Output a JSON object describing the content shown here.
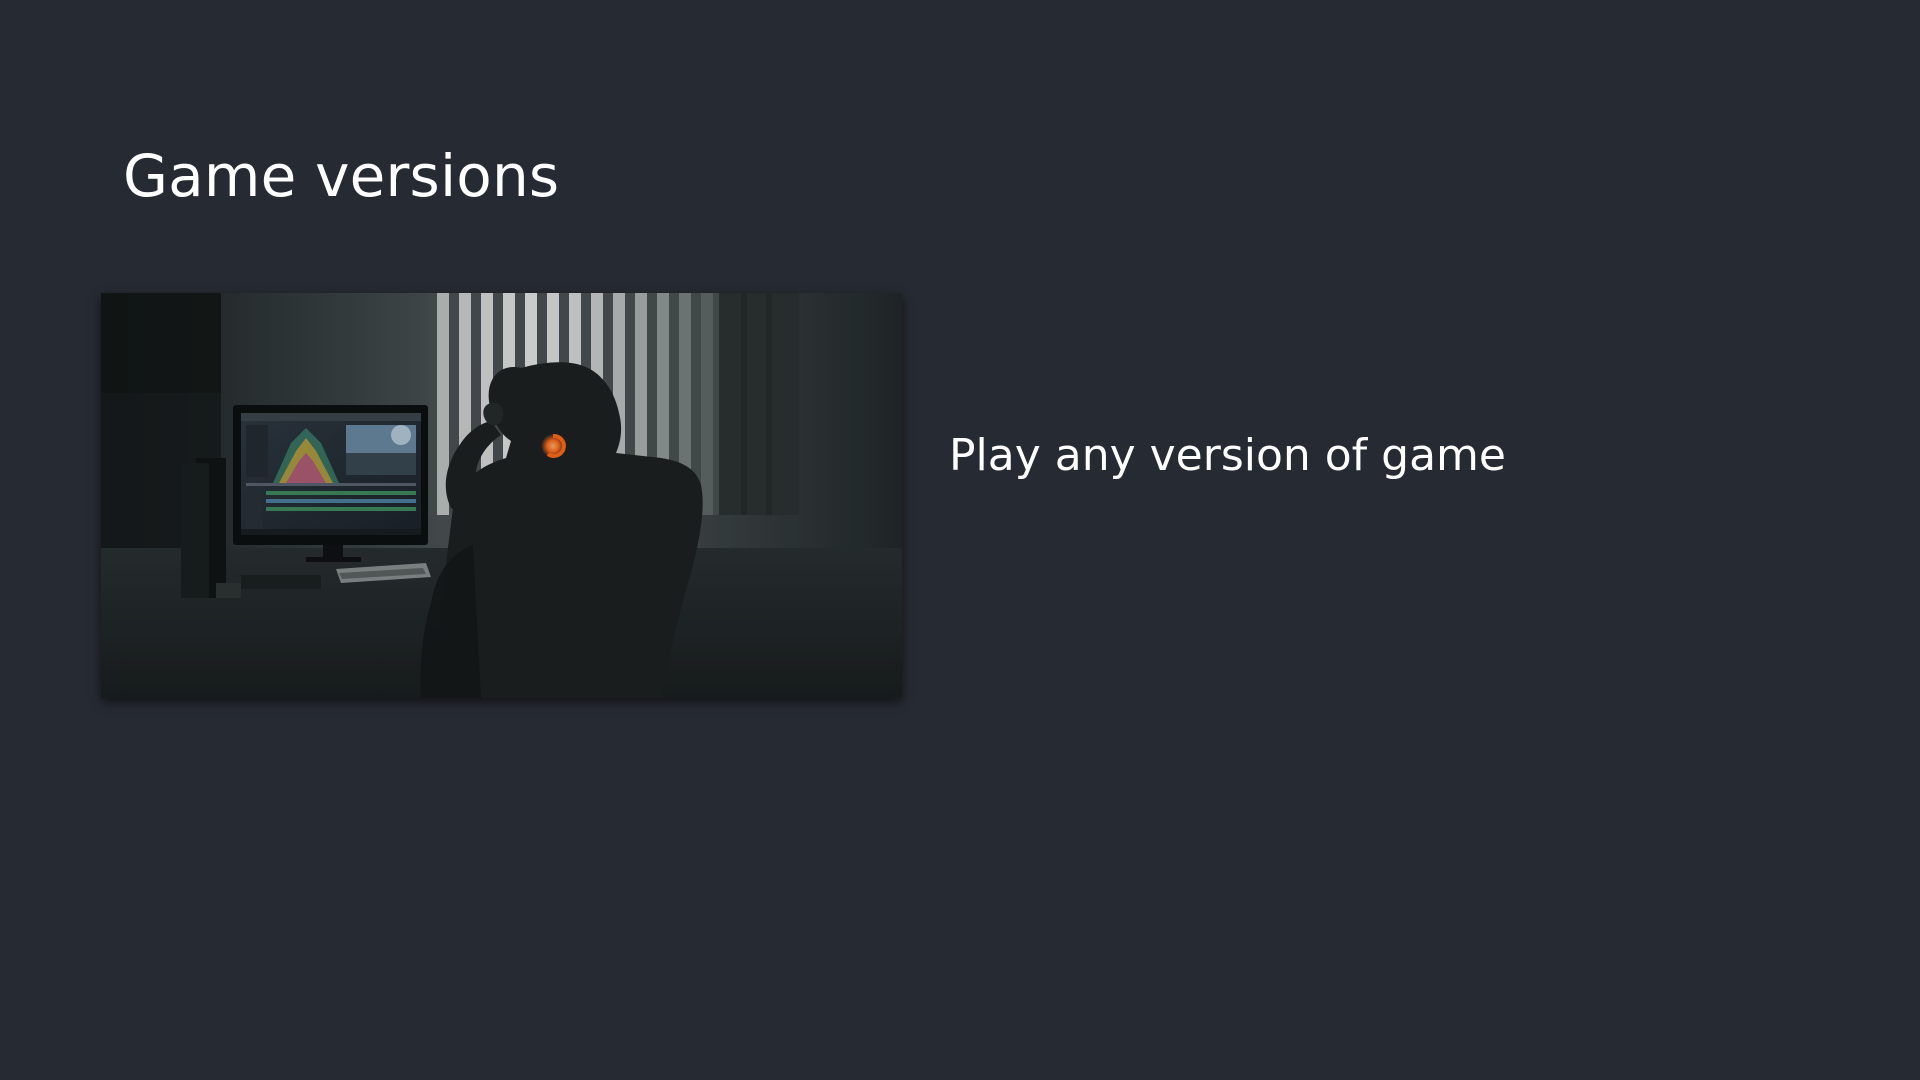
{
  "page": {
    "title": "Game versions",
    "background_color": "#262a32"
  },
  "feature": {
    "image_icon": "silhouette-at-computer-photo",
    "text": "Play any version of game"
  },
  "colors": {
    "text": "#ffffff",
    "headphone_glow": "#ff6a1a"
  }
}
